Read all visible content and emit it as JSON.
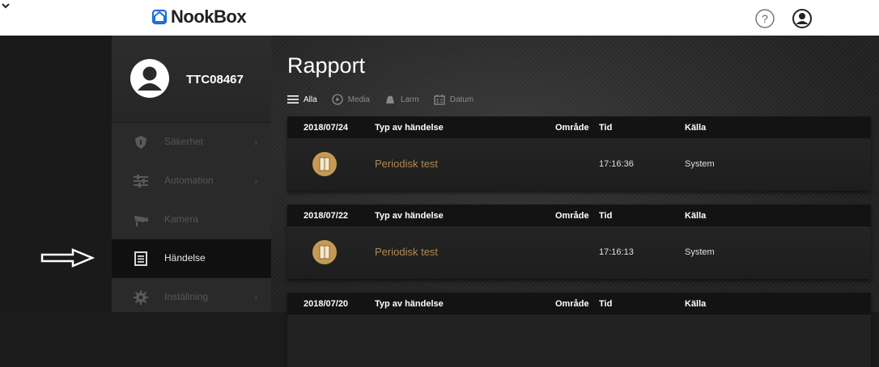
{
  "app": {
    "logo_text": "NookBox"
  },
  "user": {
    "name": "TTC08467"
  },
  "sidebar": {
    "items": [
      {
        "label": "Säkerhet",
        "icon": "shield-icon",
        "chevron": "›"
      },
      {
        "label": "Automation",
        "icon": "sliders-icon",
        "chevron": "›"
      },
      {
        "label": "Kamera",
        "icon": "camera-icon",
        "chevron": ""
      },
      {
        "label": "Händelse",
        "icon": "list-icon",
        "chevron": ""
      },
      {
        "label": "Inställning",
        "icon": "gear-icon",
        "chevron": "›"
      }
    ],
    "active_index": 3
  },
  "main": {
    "title": "Rapport",
    "filters": [
      {
        "label": "Alla",
        "icon": "menu-icon"
      },
      {
        "label": "Media",
        "icon": "play-icon"
      },
      {
        "label": "Larm",
        "icon": "bell-icon"
      },
      {
        "label": "Datum",
        "icon": "calendar-icon"
      }
    ],
    "columns": {
      "type": "Typ av händelse",
      "area": "Område",
      "time": "Tid",
      "source": "Källa"
    },
    "events": [
      {
        "date": "2018/07/24",
        "name": "Periodisk test",
        "area": "",
        "time": "17:16:36",
        "source": "System"
      },
      {
        "date": "2018/07/22",
        "name": "Periodisk test",
        "area": "",
        "time": "17:16:13",
        "source": "System"
      },
      {
        "date": "2018/07/20",
        "name": "",
        "area": "",
        "time": "",
        "source": ""
      }
    ]
  },
  "colors": {
    "accent": "#b08a4f",
    "logo_blue": "#1e6fd9"
  }
}
